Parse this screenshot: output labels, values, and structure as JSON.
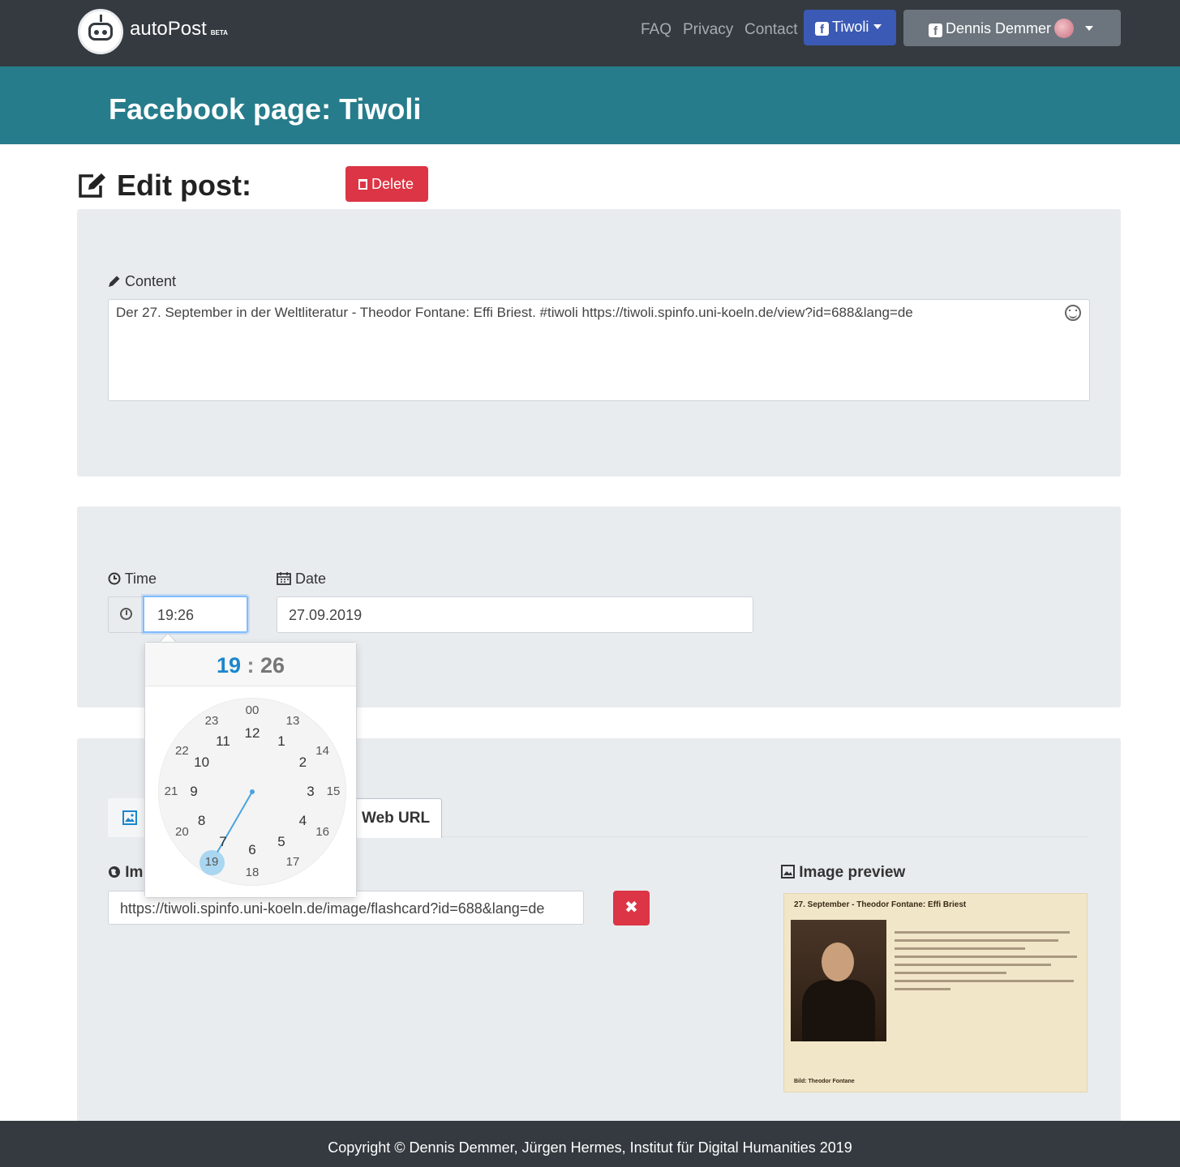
{
  "navbar": {
    "brand": "autoPost",
    "badge": "BETA",
    "links": [
      "FAQ",
      "Privacy",
      "Contact"
    ],
    "page_button": "Tiwoli",
    "user_button": "Dennis Demmer"
  },
  "header": {
    "title": "Facebook page: Tiwoli"
  },
  "edit": {
    "title": "Edit post:",
    "delete_label": "Delete"
  },
  "content": {
    "label": "Content",
    "text": "Der 27. September in der Weltliteratur - Theodor Fontane: Effi Briest. #tiwoli https://tiwoli.spinfo.uni-koeln.de/view?id=688&lang=de"
  },
  "schedule": {
    "time_label": "Time",
    "time_value": "19:26",
    "date_label": "Date",
    "date_value": "27.09.2019"
  },
  "clockpicker": {
    "hour": "19",
    "separator": ":",
    "minute": "26",
    "outer_ticks": [
      "12",
      "1",
      "2",
      "3",
      "4",
      "5",
      "6",
      "7",
      "8",
      "9",
      "10",
      "11"
    ],
    "inner_ticks": [
      "00",
      "13",
      "14",
      "15",
      "16",
      "17",
      "18",
      "19",
      "20",
      "21",
      "22",
      "23"
    ],
    "selected": "19"
  },
  "image": {
    "tab_web_url": "Web URL",
    "url_label": "Im",
    "url_value": "https://tiwoli.spinfo.uni-koeln.de/image/flashcard?id=688&lang=de",
    "remove_label": "✖",
    "preview_label": "Image preview",
    "preview_title": "27. September - Theodor Fontane: Effi Briest",
    "preview_footer": "Bild: Theodor Fontane"
  },
  "footer": {
    "copyright": "Copyright © Dennis Demmer, Jürgen Hermes, Institut für Digital Humanities 2019"
  },
  "colors": {
    "navbar": "#343a40",
    "header": "#267c8b",
    "danger": "#dc3545",
    "facebook": "#3b5ab5",
    "panel": "#e9ecef"
  }
}
